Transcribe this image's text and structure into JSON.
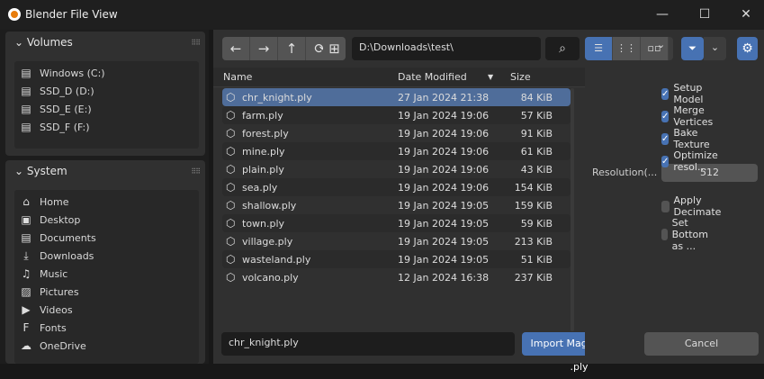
{
  "window": {
    "title": "Blender File View",
    "minimize": "—",
    "maximize": "☐",
    "close": "✕"
  },
  "sidebar": {
    "volumes": {
      "title": "Volumes",
      "items": [
        {
          "label": "Windows (C:)"
        },
        {
          "label": "SSD_D (D:)"
        },
        {
          "label": "SSD_E (E:)"
        },
        {
          "label": "SSD_F (F:)"
        }
      ]
    },
    "system": {
      "title": "System",
      "items": [
        {
          "label": "Home",
          "icon": "⌂"
        },
        {
          "label": "Desktop",
          "icon": "▣"
        },
        {
          "label": "Documents",
          "icon": "▤"
        },
        {
          "label": "Downloads",
          "icon": "⤓"
        },
        {
          "label": "Music",
          "icon": "♫"
        },
        {
          "label": "Pictures",
          "icon": "▨"
        },
        {
          "label": "Videos",
          "icon": "▶"
        },
        {
          "label": "Fonts",
          "icon": "F"
        },
        {
          "label": "OneDrive",
          "icon": "☁"
        }
      ]
    }
  },
  "toolbar": {
    "path": "D:\\Downloads\\test\\"
  },
  "columns": {
    "name": "Name",
    "date": "Date Modified",
    "size": "Size"
  },
  "files": [
    {
      "name": "chr_knight.ply",
      "date": "27 Jan 2024 21:38",
      "size": "84 KiB"
    },
    {
      "name": "farm.ply",
      "date": "19 Jan 2024 19:06",
      "size": "57 KiB"
    },
    {
      "name": "forest.ply",
      "date": "19 Jan 2024 19:06",
      "size": "91 KiB"
    },
    {
      "name": "mine.ply",
      "date": "19 Jan 2024 19:06",
      "size": "61 KiB"
    },
    {
      "name": "plain.ply",
      "date": "19 Jan 2024 19:06",
      "size": "43 KiB"
    },
    {
      "name": "sea.ply",
      "date": "19 Jan 2024 19:06",
      "size": "154 KiB"
    },
    {
      "name": "shallow.ply",
      "date": "19 Jan 2024 19:05",
      "size": "159 KiB"
    },
    {
      "name": "town.ply",
      "date": "19 Jan 2024 19:05",
      "size": "59 KiB"
    },
    {
      "name": "village.ply",
      "date": "19 Jan 2024 19:05",
      "size": "213 KiB"
    },
    {
      "name": "wasteland.ply",
      "date": "19 Jan 2024 19:05",
      "size": "51 KiB"
    },
    {
      "name": "volcano.ply",
      "date": "12 Jan 2024 16:38",
      "size": "237 KiB"
    }
  ],
  "options": {
    "setup_model": {
      "label": "Setup Model",
      "checked": true
    },
    "merge_vertices": {
      "label": "Merge Vertices",
      "checked": true
    },
    "bake_texture": {
      "label": "Bake Texture",
      "checked": true
    },
    "optimize": {
      "label": "Optimize resol...",
      "checked": true
    },
    "resolution_label": "Resolution(...",
    "resolution_value": "512",
    "apply_decimate": {
      "label": "Apply Decimate",
      "checked": false
    },
    "set_bottom": {
      "label": "Set Bottom as ...",
      "checked": false
    }
  },
  "footer": {
    "filename": "chr_knight.ply",
    "import": "Import Magicavoxel .ply",
    "cancel": "Cancel"
  }
}
